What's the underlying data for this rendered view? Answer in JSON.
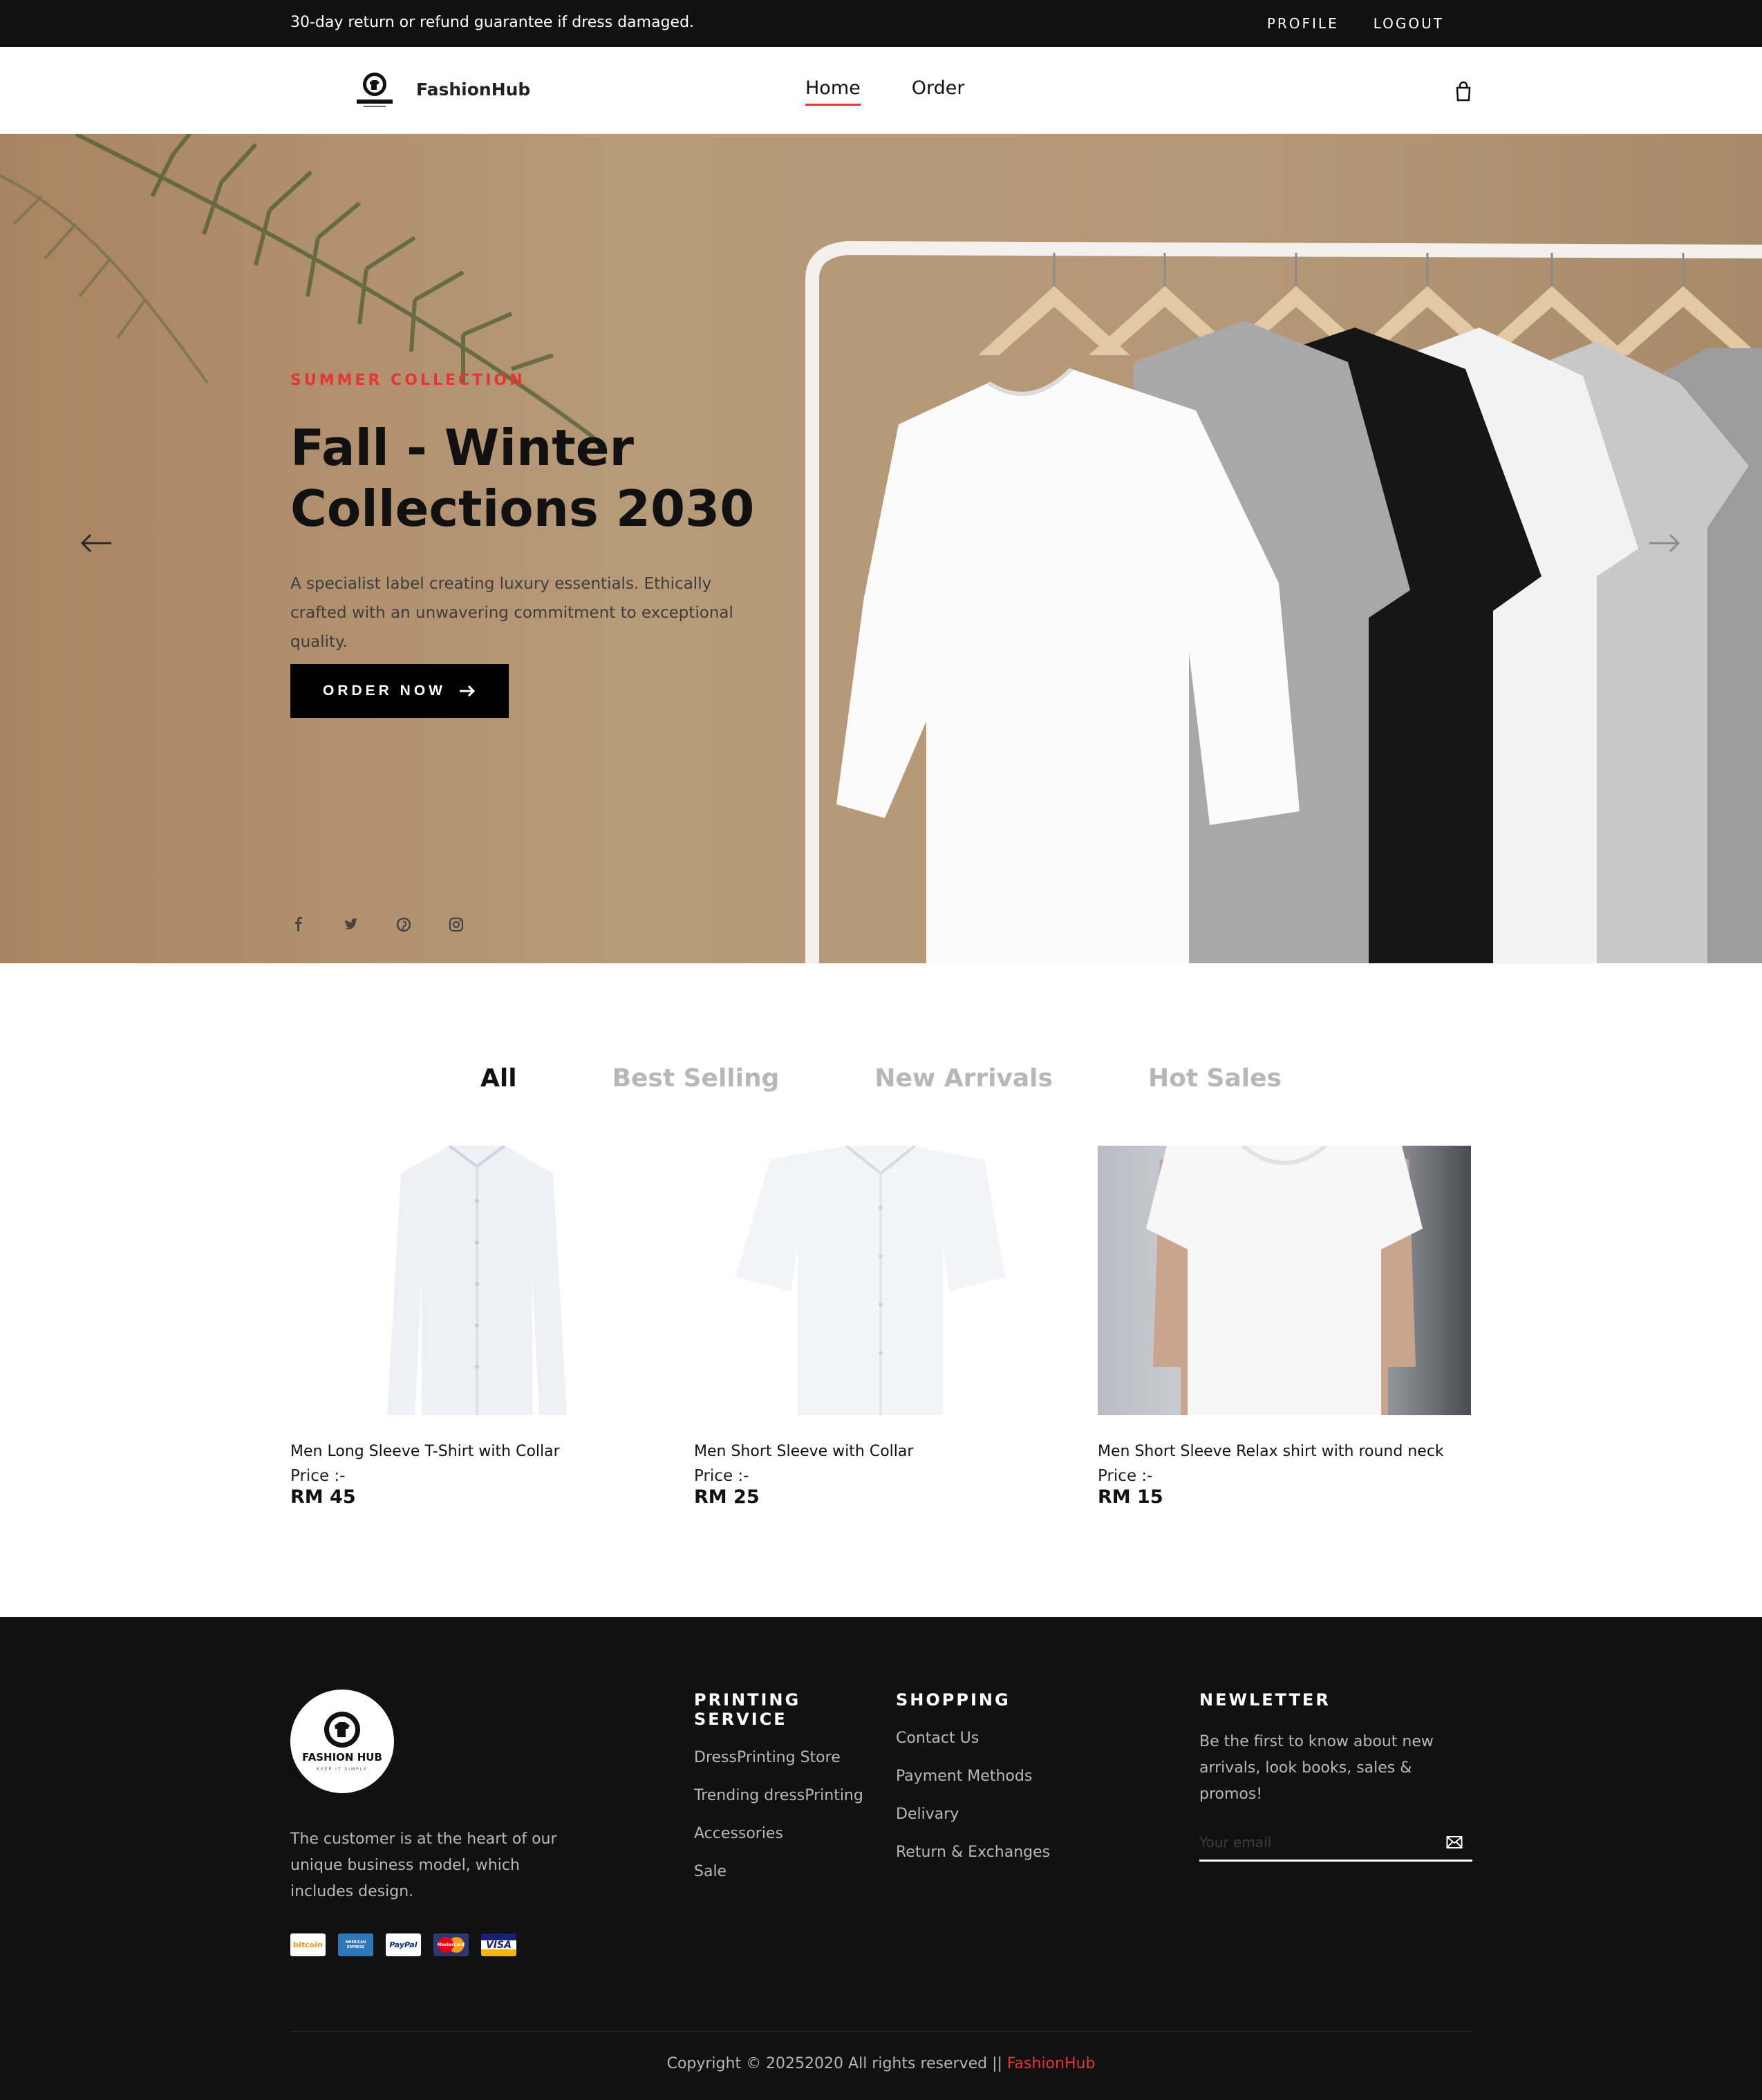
{
  "topbar": {
    "notice": "30-day return or refund guarantee if dress damaged.",
    "profile": "PROFILE",
    "logout": "LOGOUT"
  },
  "header": {
    "brand": "FashionHub",
    "nav": [
      "Home",
      "Order"
    ],
    "active_nav": "Home",
    "cart_icon": "shopping-bag-icon"
  },
  "hero": {
    "subtitle": "SUMMER COLLECTION",
    "title": "Fall - Winter Collections 2030",
    "description": "A specialist label creating luxury essentials. Ethically crafted with an unwavering commitment to exceptional quality.",
    "button": "ORDER NOW",
    "socials": [
      "facebook-icon",
      "twitter-icon",
      "pinterest-icon",
      "instagram-icon"
    ]
  },
  "filters": {
    "tabs": [
      "All",
      "Best Selling",
      "New Arrivals",
      "Hot Sales"
    ],
    "active": "All"
  },
  "products": [
    {
      "name": "Men Long Sleeve T-Shirt with Collar",
      "price_label": "Price :-",
      "price": "RM 45"
    },
    {
      "name": "Men Short Sleeve with Collar",
      "price_label": "Price :-",
      "price": "RM 25"
    },
    {
      "name": "Men Short Sleeve Relax shirt with round neck",
      "price_label": "Price :-",
      "price": "RM 15"
    }
  ],
  "footer": {
    "about": "The customer is at the heart of our unique business model, which includes design.",
    "logo_text": "FASHION HUB",
    "logo_tagline": "KEEP IT SIMPLE",
    "payments": [
      "bitcoin",
      "AMERICAN EXPRESS",
      "PayPal",
      "MasterCard",
      "VISA"
    ],
    "printing": {
      "title": "PRINTING SERVICE",
      "items": [
        "DressPrinting Store",
        "Trending dressPrinting",
        "Accessories",
        "Sale"
      ]
    },
    "shopping": {
      "title": "SHOPPING",
      "items": [
        "Contact Us",
        "Payment Methods",
        "Delivary",
        "Return & Exchanges"
      ]
    },
    "newsletter": {
      "title": "NEWLETTER",
      "text": "Be the first to know about new arrivals, look books, sales & promos!",
      "placeholder": "Your email"
    },
    "copyright": "Copyright © 20252020 All rights reserved ||",
    "copyright_brand": "FashionHub"
  },
  "colors": {
    "accent": "#e53637",
    "dark": "#111111",
    "muted": "#b7b7b7"
  }
}
